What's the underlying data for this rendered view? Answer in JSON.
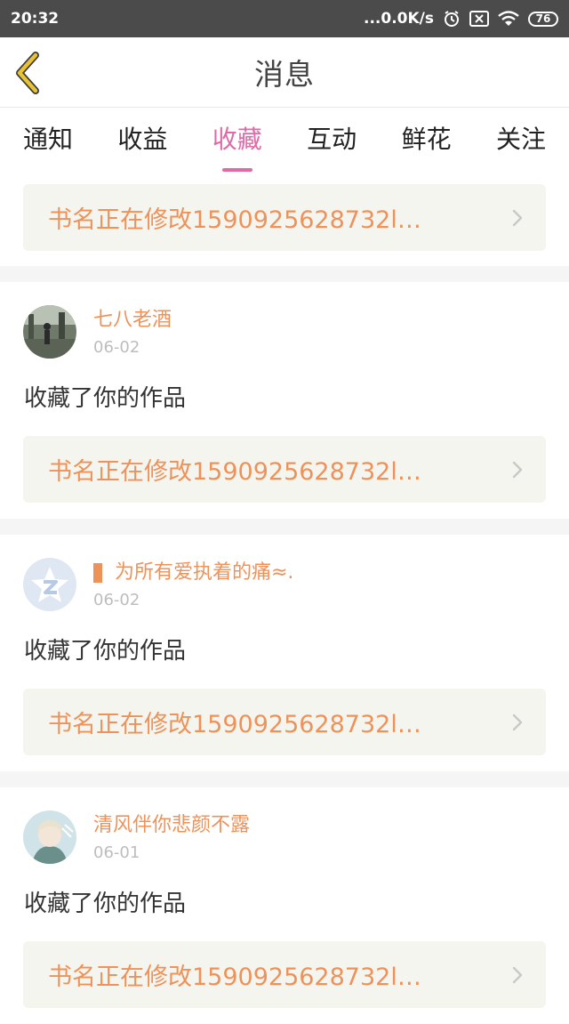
{
  "status": {
    "time": "20:32",
    "network": "...0.0K/s",
    "battery": "76"
  },
  "header": {
    "title": "消息"
  },
  "tabs": [
    {
      "label": "通知"
    },
    {
      "label": "收益"
    },
    {
      "label": "收藏",
      "active": true
    },
    {
      "label": "互动"
    },
    {
      "label": "鲜花"
    },
    {
      "label": "关注"
    }
  ],
  "top_card": {
    "book_title": "书名正在修改1590925628732l…"
  },
  "messages": [
    {
      "user": "七八老酒",
      "date": "06-02",
      "text": "收藏了你的作品",
      "book_title": "书名正在修改1590925628732l…"
    },
    {
      "user": "为所有爱执着的痛≈.",
      "date": "06-02",
      "text": "收藏了你的作品",
      "book_title": "书名正在修改1590925628732l…"
    },
    {
      "user": "清风伴你悲颜不露",
      "date": "06-01",
      "text": "收藏了你的作品",
      "book_title": "书名正在修改1590925628732l…"
    }
  ],
  "colors": {
    "accent_pink": "#e06aa8",
    "accent_orange": "#ee9259",
    "back_arrow": "#e9c233"
  }
}
